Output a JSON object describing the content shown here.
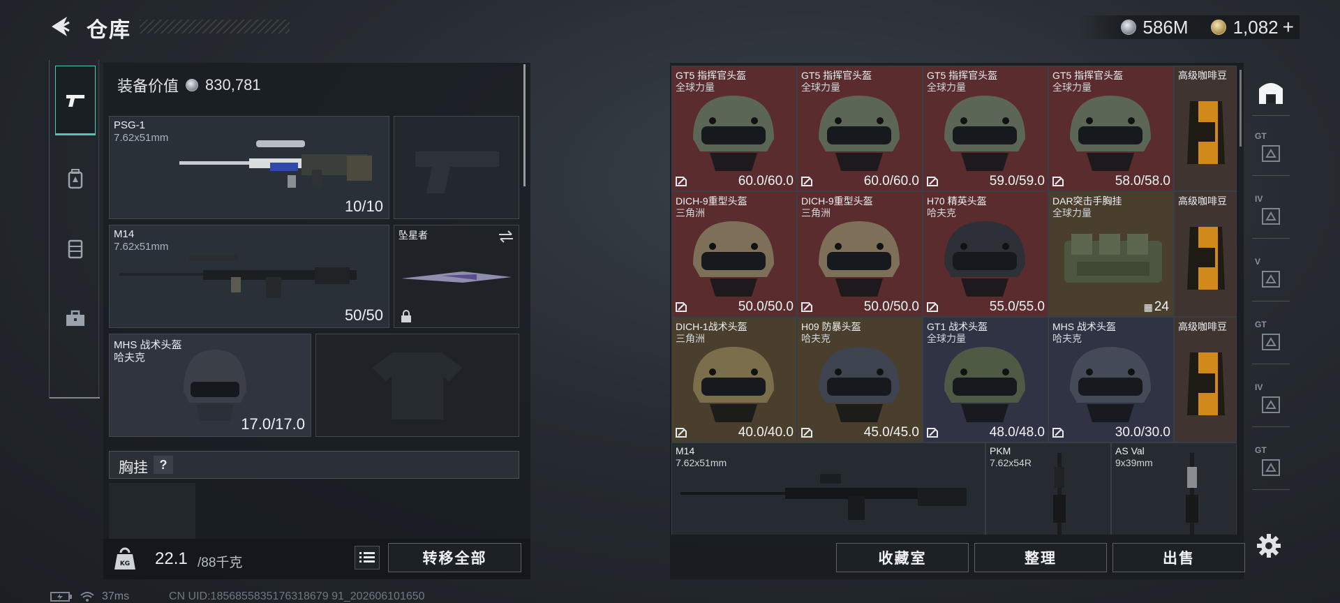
{
  "header": {
    "title": "仓库",
    "silver_amount": "586M",
    "gold_amount": "1,082",
    "gold_plus": "+"
  },
  "left_tabs": [
    {
      "icon": "pistol-icon",
      "active": true
    },
    {
      "icon": "backpack-icon",
      "active": false
    },
    {
      "icon": "vest-icon",
      "active": false
    },
    {
      "icon": "toolbox-icon",
      "active": false
    }
  ],
  "loadout": {
    "equip_value_label": "装备价值",
    "equip_value": "830,781",
    "primary_1": {
      "name": "PSG-1",
      "caliber": "7.62x51mm",
      "ammo": "10/10"
    },
    "primary_2": {
      "name": "M14",
      "caliber": "7.62x51mm",
      "ammo": "50/50"
    },
    "melee": {
      "name": "坠星者"
    },
    "helmet": {
      "name": "MHS 战术头盔",
      "faction": "哈夫克",
      "durability": "17.0/17.0"
    },
    "chest_rig_label": "胸挂",
    "chest_rig_help": "?",
    "weight_current": "22.1",
    "weight_max": "/88千克",
    "transfer_all": "转移全部"
  },
  "storage": {
    "rows": [
      [
        {
          "name": "GT5 指挥官头盔",
          "faction": "全球力量",
          "durability": "60.0/60.0",
          "bg": "red",
          "icon": "helmet-icon"
        },
        {
          "name": "GT5 指挥官头盔",
          "faction": "全球力量",
          "durability": "60.0/60.0",
          "bg": "red",
          "icon": "helmet-icon"
        },
        {
          "name": "GT5 指挥官头盔",
          "faction": "全球力量",
          "durability": "59.0/59.0",
          "bg": "red",
          "icon": "helmet-icon"
        },
        {
          "name": "GT5 指挥官头盔",
          "faction": "全球力量",
          "durability": "58.0/58.0",
          "bg": "red",
          "icon": "helmet-icon"
        },
        {
          "name": "高级咖啡豆",
          "bg": "brown",
          "icon": "coffee-bag-icon"
        }
      ],
      [
        {
          "name": "DICH-9重型头盔",
          "faction": "三角洲",
          "durability": "50.0/50.0",
          "bg": "red",
          "icon": "helmet-icon"
        },
        {
          "name": "DICH-9重型头盔",
          "faction": "三角洲",
          "durability": "50.0/50.0",
          "bg": "red",
          "icon": "helmet-icon"
        },
        {
          "name": "H70 精英头盔",
          "faction": "哈夫克",
          "durability": "55.0/55.0",
          "bg": "red",
          "icon": "helmet-icon"
        },
        {
          "name": "DAR突击手胸挂",
          "faction": "全球力量",
          "quantity": "24",
          "bg": "olive",
          "icon": "chest-rig-icon"
        },
        {
          "name": "高级咖啡豆",
          "bg": "brown",
          "icon": "coffee-bag-icon"
        }
      ],
      [
        {
          "name": "DICH-1战术头盔",
          "faction": "三角洲",
          "durability": "40.0/40.0",
          "bg": "olive",
          "icon": "helmet-icon"
        },
        {
          "name": "H09 防暴头盔",
          "faction": "哈夫克",
          "durability": "45.0/45.0",
          "bg": "olive",
          "icon": "helmet-icon"
        },
        {
          "name": "GT1 战术头盔",
          "faction": "全球力量",
          "durability": "48.0/48.0",
          "bg": "navy",
          "icon": "helmet-icon"
        },
        {
          "name": "MHS 战术头盔",
          "faction": "哈夫克",
          "durability": "30.0/30.0",
          "bg": "navy",
          "icon": "helmet-icon"
        },
        {
          "name": "高级咖啡豆",
          "bg": "brown",
          "icon": "coffee-bag-icon"
        }
      ]
    ],
    "weapons": [
      {
        "name": "M14",
        "caliber": "7.62x51mm"
      },
      {
        "name": "PKM",
        "caliber": "7.62x54R"
      },
      {
        "name": "AS Val",
        "caliber": "9x39mm"
      }
    ],
    "buttons": {
      "collection": "收藏室",
      "sort": "整理",
      "sell": "出售"
    }
  },
  "right_tabs": [
    {
      "icon": "home-base-icon",
      "label": ""
    },
    {
      "icon": "gt-tab-icon",
      "label": "GT"
    },
    {
      "icon": "iv-tab-icon",
      "label": "IV"
    },
    {
      "icon": "v-tab-icon",
      "label": "V"
    },
    {
      "icon": "gt-tab-icon",
      "label": "GT"
    },
    {
      "icon": "iv-tab-icon",
      "label": "IV"
    },
    {
      "icon": "gt-tab-icon",
      "label": "GT"
    }
  ],
  "status": {
    "ping": "37ms",
    "uid": "CN UID:1856855835176318679 91_202606101650"
  },
  "colors": {
    "accent": "#56c6b4",
    "red_rarity": "#5a2c2e",
    "olive_rarity": "#4a3e2c",
    "navy_rarity": "#2f3344"
  }
}
